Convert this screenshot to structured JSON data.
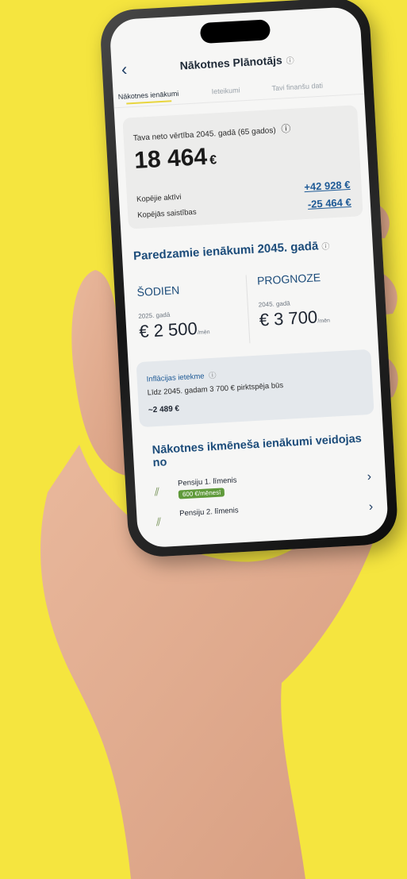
{
  "header": {
    "title": "Nākotnes Plānotājs",
    "back_glyph": "‹",
    "info_glyph": "ⓘ"
  },
  "tabs": [
    {
      "label": "Nākotnes ienākumi",
      "active": true
    },
    {
      "label": "Ieteikumi",
      "active": false
    },
    {
      "label": "Tavi finanšu dati",
      "active": false
    }
  ],
  "net_worth": {
    "label": "Tava neto vērtība 2045. gadā (65 gados)",
    "value": "18 464",
    "currency": "€",
    "assets_label": "Kopējie aktīvi",
    "assets_value": "+42 928 €",
    "liabilities_label": "Kopējās saistības",
    "liabilities_value": "-25 464 €"
  },
  "expected_income": {
    "title": "Paredzamie ienākumi 2045. gadā",
    "today": {
      "head": "ŠODIEN",
      "year": "2025. gadā",
      "amount": "€ 2 500",
      "unit": "/mēn"
    },
    "forecast": {
      "head": "PROGNOZE",
      "year": "2045. gadā",
      "amount": "€ 3 700",
      "unit": "/mēn"
    }
  },
  "inflation": {
    "title": "Inflācijas ietekme",
    "text": "Līdz 2045. gadam 3 700 € pirktspēja būs",
    "value": "~2 489 €"
  },
  "sources": {
    "title": "Nākotnes ikmēneša ienākumi veidojas no",
    "items": [
      {
        "label": "Pensiju 1. līmenis",
        "badge": "600 €/mēnesī"
      },
      {
        "label": "Pensiju 2. līmenis",
        "badge": ""
      }
    ]
  },
  "colors": {
    "background": "#f5e53f",
    "accent_blue": "#1c4c7a",
    "badge_green": "#5f9a3a"
  }
}
